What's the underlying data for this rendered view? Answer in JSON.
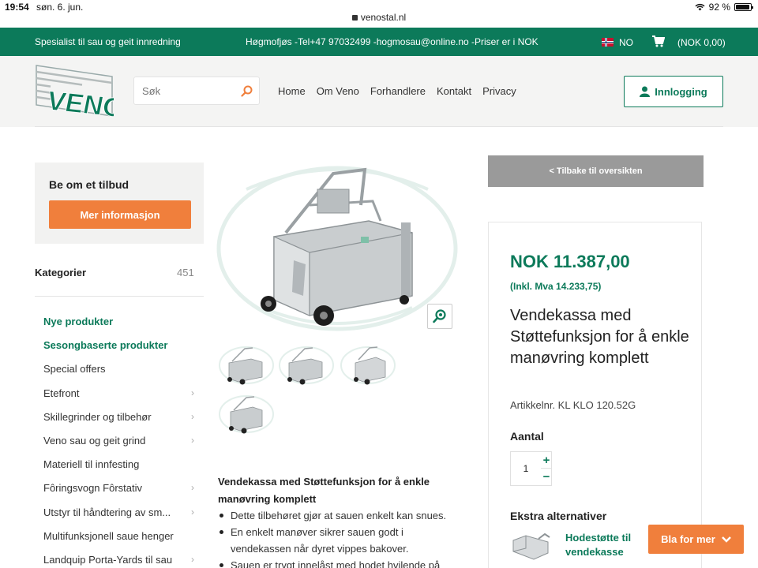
{
  "statusbar": {
    "time": "19:54",
    "date": "søn. 6. jun.",
    "battery": "92 %"
  },
  "browser": {
    "url": "venostal.nl"
  },
  "topbar": {
    "tagline": "Spesialist til sau og geit innredning",
    "contact": "Høgmofjøs -Tel+47 97032499 -hogmosau@online.no -Priser er i NOK",
    "language": "NO",
    "cart": "(NOK  0,00)"
  },
  "header": {
    "logo_text": "VENO",
    "search_placeholder": "Søk",
    "nav": [
      "Home",
      "Om Veno",
      "Forhandlere",
      "Kontakt",
      "Privacy"
    ],
    "login_label": "Innlogging"
  },
  "sidebar": {
    "quote_title": "Be om et tilbud",
    "quote_button": "Mer informasjon",
    "categories_title": "Kategorier",
    "categories_count": "451",
    "categories": [
      {
        "label": "Nye produkter",
        "highlight": true,
        "has_children": false
      },
      {
        "label": "Sesongbaserte produkter",
        "highlight": true,
        "has_children": false
      },
      {
        "label": "Special offers",
        "highlight": false,
        "has_children": false
      },
      {
        "label": "Etefront",
        "highlight": false,
        "has_children": true
      },
      {
        "label": "Skillegrinder og tilbehør",
        "highlight": false,
        "has_children": true
      },
      {
        "label": "Veno sau og geit grind",
        "highlight": false,
        "has_children": true
      },
      {
        "label": "Materiell til innfesting",
        "highlight": false,
        "has_children": false
      },
      {
        "label": "Fôringsvogn Fôrstativ",
        "highlight": false,
        "has_children": true
      },
      {
        "label": "Utstyr til håndtering av sm...",
        "highlight": false,
        "has_children": true
      },
      {
        "label": "Multifunksjonell saue henger",
        "highlight": false,
        "has_children": false
      },
      {
        "label": "Landquip Porta-Yards til sau",
        "highlight": false,
        "has_children": true
      }
    ]
  },
  "product": {
    "back_label": "< Tilbake til oversikten",
    "price": "NOK 11.387,00",
    "price_incl": "(Inkl. Mva 14.233,75)",
    "title": "Vendekassa med Støttefunksjon for å enkle manøvring komplett",
    "article_nr": "Artikkelnr. KL KLO 120.52G",
    "quantity_label": "Aantal",
    "quantity_value": "1",
    "qty_plus": "+",
    "qty_minus": "−",
    "extra_title": "Ekstra alternativer",
    "extra_item": "Hodestøtte til vendekasse",
    "description_title": "Vendekassa med Støttefunksjon for å enkle manøvring komplett",
    "bullets": [
      "Dette tilbehøret gjør at sauen enkelt kan snues.",
      "En enkelt manøver sikrer sauen godt i vendekassen når dyret vippes bakover.",
      "Sauen er trygt innelåst med hodet hvilende på"
    ]
  },
  "floating": {
    "browse_label": "Bla for mer"
  },
  "colors": {
    "brand_green": "#0c7a5a",
    "accent_orange": "#f07f3c",
    "back_gray": "#9a9a9a"
  }
}
